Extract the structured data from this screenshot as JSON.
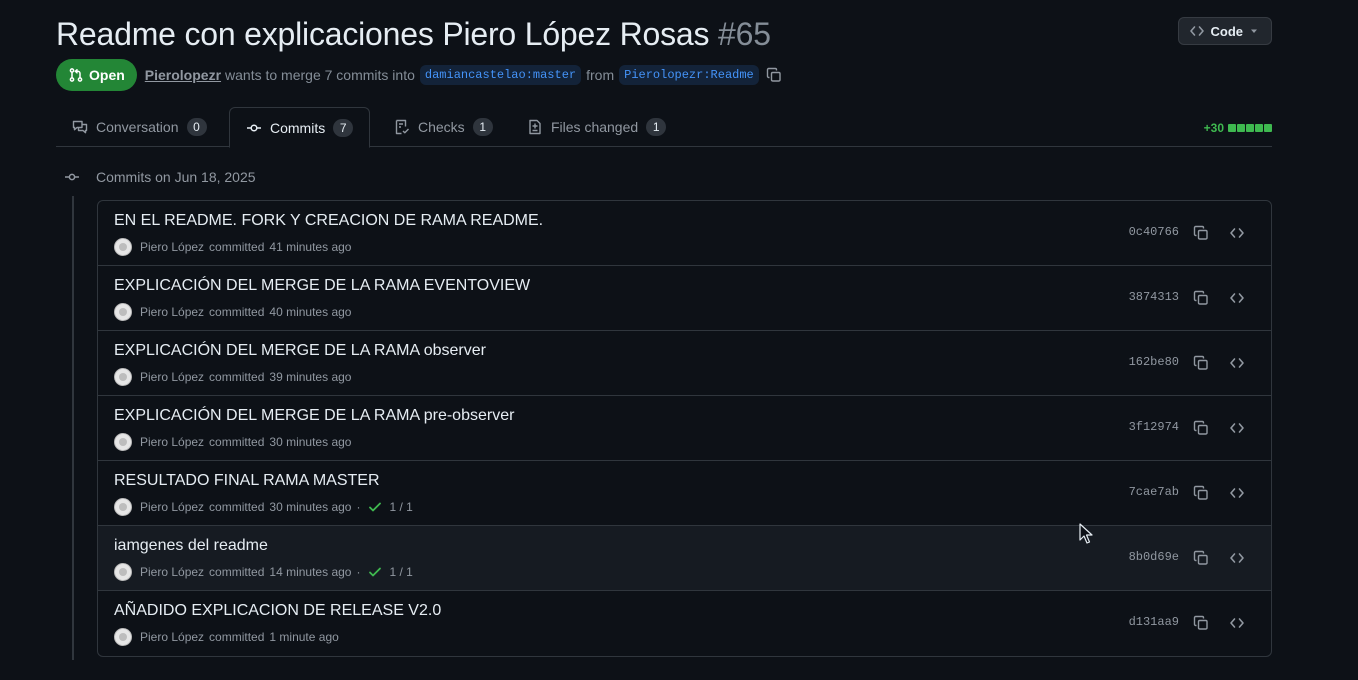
{
  "header": {
    "title": "Readme con explicaciones Piero López Rosas",
    "number": "#65",
    "code_button": "Code"
  },
  "meta": {
    "state": "Open",
    "author": "Pierolopezr",
    "text_middle": "wants to merge 7 commits into",
    "base_branch": "damiancastelao:master",
    "text_from": "from",
    "head_branch": "Pierolopezr:Readme"
  },
  "tabs": [
    {
      "label": "Conversation",
      "count": "0",
      "icon": "conversation-icon"
    },
    {
      "label": "Commits",
      "count": "7",
      "icon": "commit-icon"
    },
    {
      "label": "Checks",
      "count": "1",
      "icon": "checklist-icon"
    },
    {
      "label": "Files changed",
      "count": "1",
      "icon": "file-diff-icon"
    }
  ],
  "diffstat": "+30",
  "timeline": {
    "group_label": "Commits on Jun 18, 2025"
  },
  "commits": [
    {
      "title": "EN EL README. FORK Y CREACION DE RAMA README.",
      "author": "Piero López",
      "verb": "committed",
      "time": "41 minutes ago",
      "checks": "",
      "sha": "0c40766"
    },
    {
      "title": "EXPLICACIÓN DEL MERGE DE LA RAMA EVENTOVIEW",
      "author": "Piero López",
      "verb": "committed",
      "time": "40 minutes ago",
      "checks": "",
      "sha": "3874313"
    },
    {
      "title": "EXPLICACIÓN DEL MERGE DE LA RAMA observer",
      "author": "Piero López",
      "verb": "committed",
      "time": "39 minutes ago",
      "checks": "",
      "sha": "162be80"
    },
    {
      "title": "EXPLICACIÓN DEL MERGE DE LA RAMA pre-observer",
      "author": "Piero López",
      "verb": "committed",
      "time": "30 minutes ago",
      "checks": "",
      "sha": "3f12974"
    },
    {
      "title": "RESULTADO FINAL RAMA MASTER",
      "author": "Piero López",
      "verb": "committed",
      "time": "30 minutes ago",
      "checks": "1 / 1",
      "sha": "7cae7ab"
    },
    {
      "title": "iamgenes del readme",
      "author": "Piero López",
      "verb": "committed",
      "time": "14 minutes ago",
      "checks": "1 / 1",
      "sha": "8b0d69e"
    },
    {
      "title": "AÑADIDO EXPLICACION DE RELEASE V2.0",
      "author": "Piero López",
      "verb": "committed",
      "time": "1 minute ago",
      "checks": "",
      "sha": "d131aa9"
    }
  ],
  "colors": {
    "background": "#0d1117",
    "open_badge": "#238636",
    "branch_text": "#4493f8",
    "success": "#3fb950"
  }
}
